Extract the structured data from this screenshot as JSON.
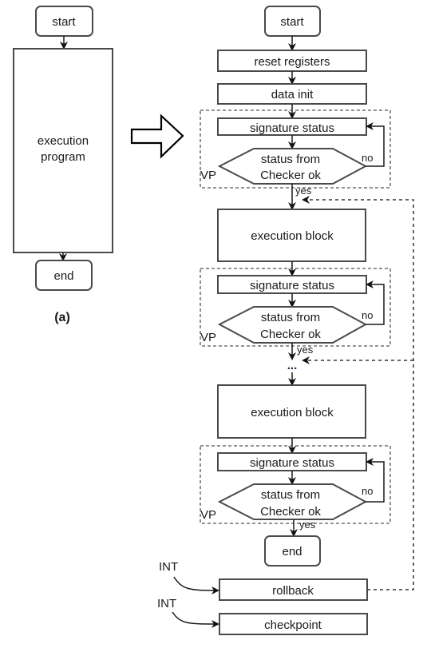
{
  "diagram": {
    "left": {
      "start": "start",
      "program_line1": "execution",
      "program_line2": "program",
      "end": "end",
      "caption": "(a)"
    },
    "transform_arrow": "right-arrow-icon",
    "right": {
      "start": "start",
      "reset": "reset registers",
      "init": "data init",
      "stages": [
        {
          "signature": "signature status",
          "decision_line1": "status from",
          "decision_line2": "Checker ok",
          "no_label": "no",
          "yes_label": "yes",
          "group_label": "VP"
        },
        {
          "block": "execution block",
          "signature": "signature status",
          "decision_line1": "status from",
          "decision_line2": "Checker ok",
          "no_label": "no",
          "yes_label": "yes",
          "group_label": "VP"
        },
        {
          "block": "execution block",
          "signature": "signature status",
          "decision_line1": "status from",
          "decision_line2": "Checker ok",
          "no_label": "no",
          "yes_label": "yes",
          "group_label": "VP"
        }
      ],
      "ellipsis": "...",
      "end": "end",
      "rollback": "rollback",
      "checkpoint": "checkpoint",
      "int_label_1": "INT",
      "int_label_2": "INT"
    }
  }
}
